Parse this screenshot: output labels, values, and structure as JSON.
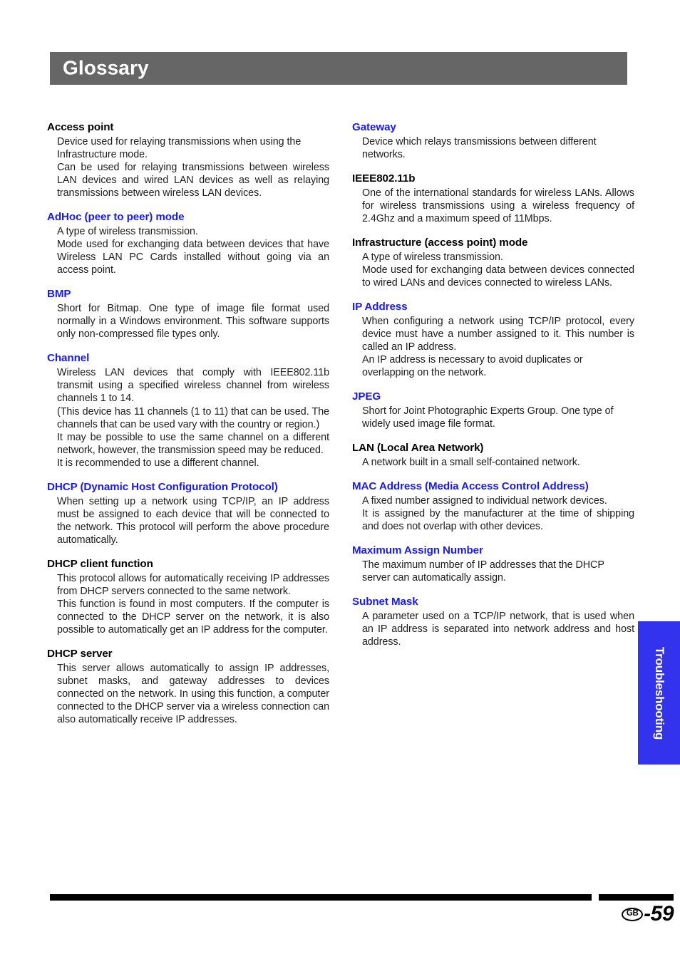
{
  "header": {
    "title": "Glossary"
  },
  "side_tab": {
    "label": "Troubleshooting",
    "color": "#3333ee"
  },
  "footer": {
    "region_code": "GB",
    "page_number": "-59"
  },
  "colors": {
    "header_band": "#666666",
    "term_blue": "#1a1aee",
    "term_black": "#000000"
  },
  "columns": [
    {
      "entries": [
        {
          "term": "Access point",
          "term_color": "black",
          "paragraphs": [
            "Device used for relaying transmissions when using the Infrastructure mode.",
            "Can be used for relaying transmissions between wireless LAN devices and wired LAN devices as well as relaying transmissions between wireless LAN devices."
          ]
        },
        {
          "term": "AdHoc (peer to peer) mode",
          "term_color": "blue",
          "paragraphs": [
            "A type of wireless transmission.",
            "Mode used for exchanging data between devices that have Wireless LAN PC Cards installed without going via an access point."
          ]
        },
        {
          "term": "BMP",
          "term_color": "blue",
          "paragraphs": [
            "Short for Bitmap. One type of image file format used normally in a Windows environment. This software supports only non-compressed file types only."
          ]
        },
        {
          "term": "Channel",
          "term_color": "blue",
          "paragraphs": [
            "Wireless LAN devices that comply with IEEE802.11b transmit using a specified wireless channel from wireless channels 1 to 14.",
            "(This device has 11 channels (1 to 11) that can be used. The channels that can be used vary with the country or region.)",
            "It may be possible to use the same channel on a different network, however, the transmission speed may be reduced.",
            "It is recommended to use a different channel."
          ]
        },
        {
          "term": "DHCP (Dynamic Host Configuration Protocol)",
          "term_color": "blue",
          "paragraphs": [
            "When setting up a network using TCP/IP, an IP address must be assigned to each device that will be connected to the network. This protocol will perform the above procedure automatically."
          ]
        },
        {
          "term": "DHCP client function",
          "term_color": "black",
          "paragraphs": [
            "This protocol allows for automatically receiving IP addresses from DHCP servers connected to the same network.",
            "This function is found in most computers. If the computer is connected to the DHCP server on the network, it is also possible to automatically get an IP address for the computer."
          ]
        },
        {
          "term": "DHCP server",
          "term_color": "black",
          "paragraphs": [
            "This server allows automatically to assign IP addresses, subnet masks, and gateway addresses to devices connected on the network. In using this function, a computer connected to the DHCP server via a wireless connection can also automatically receive IP addresses."
          ]
        }
      ]
    },
    {
      "entries": [
        {
          "term": "Gateway",
          "term_color": "blue",
          "paragraphs": [
            "Device which relays transmissions between different networks."
          ]
        },
        {
          "term": "IEEE802.11b",
          "term_color": "black",
          "paragraphs": [
            "One of the international standards for wireless LANs. Allows for wireless transmissions using a wireless frequency of 2.4Ghz and a maximum speed of 11Mbps."
          ]
        },
        {
          "term": "Infrastructure (access point) mode",
          "term_color": "black",
          "paragraphs": [
            "A type of wireless transmission.",
            "Mode used for exchanging data between devices connected to wired LANs and devices connected to wireless LANs."
          ]
        },
        {
          "term": "IP Address",
          "term_color": "blue",
          "paragraphs": [
            "When configuring a network using TCP/IP protocol, every device must have a number assigned to it. This number is called an IP address.",
            "An IP address is necessary to avoid duplicates or overlapping on the network."
          ]
        },
        {
          "term": "JPEG",
          "term_color": "blue",
          "paragraphs": [
            "Short for Joint Photographic Experts Group. One type of widely used image file format."
          ]
        },
        {
          "term": "LAN (Local Area Network)",
          "term_color": "black",
          "paragraphs": [
            "A network built in a small self-contained network."
          ]
        },
        {
          "term": "MAC Address (Media Access Control Address)",
          "term_color": "blue",
          "paragraphs": [
            "A fixed number assigned to individual network devices.",
            "It is assigned by the manufacturer at the time of shipping and does not overlap with other devices."
          ]
        },
        {
          "term": "Maximum Assign Number",
          "term_color": "blue",
          "paragraphs": [
            "The maximum number of IP addresses that the DHCP server can automatically assign."
          ]
        },
        {
          "term": "Subnet Mask",
          "term_color": "blue",
          "paragraphs": [
            "A parameter used on a TCP/IP network, that is used when an IP address is separated into network address and host address."
          ]
        }
      ]
    }
  ]
}
